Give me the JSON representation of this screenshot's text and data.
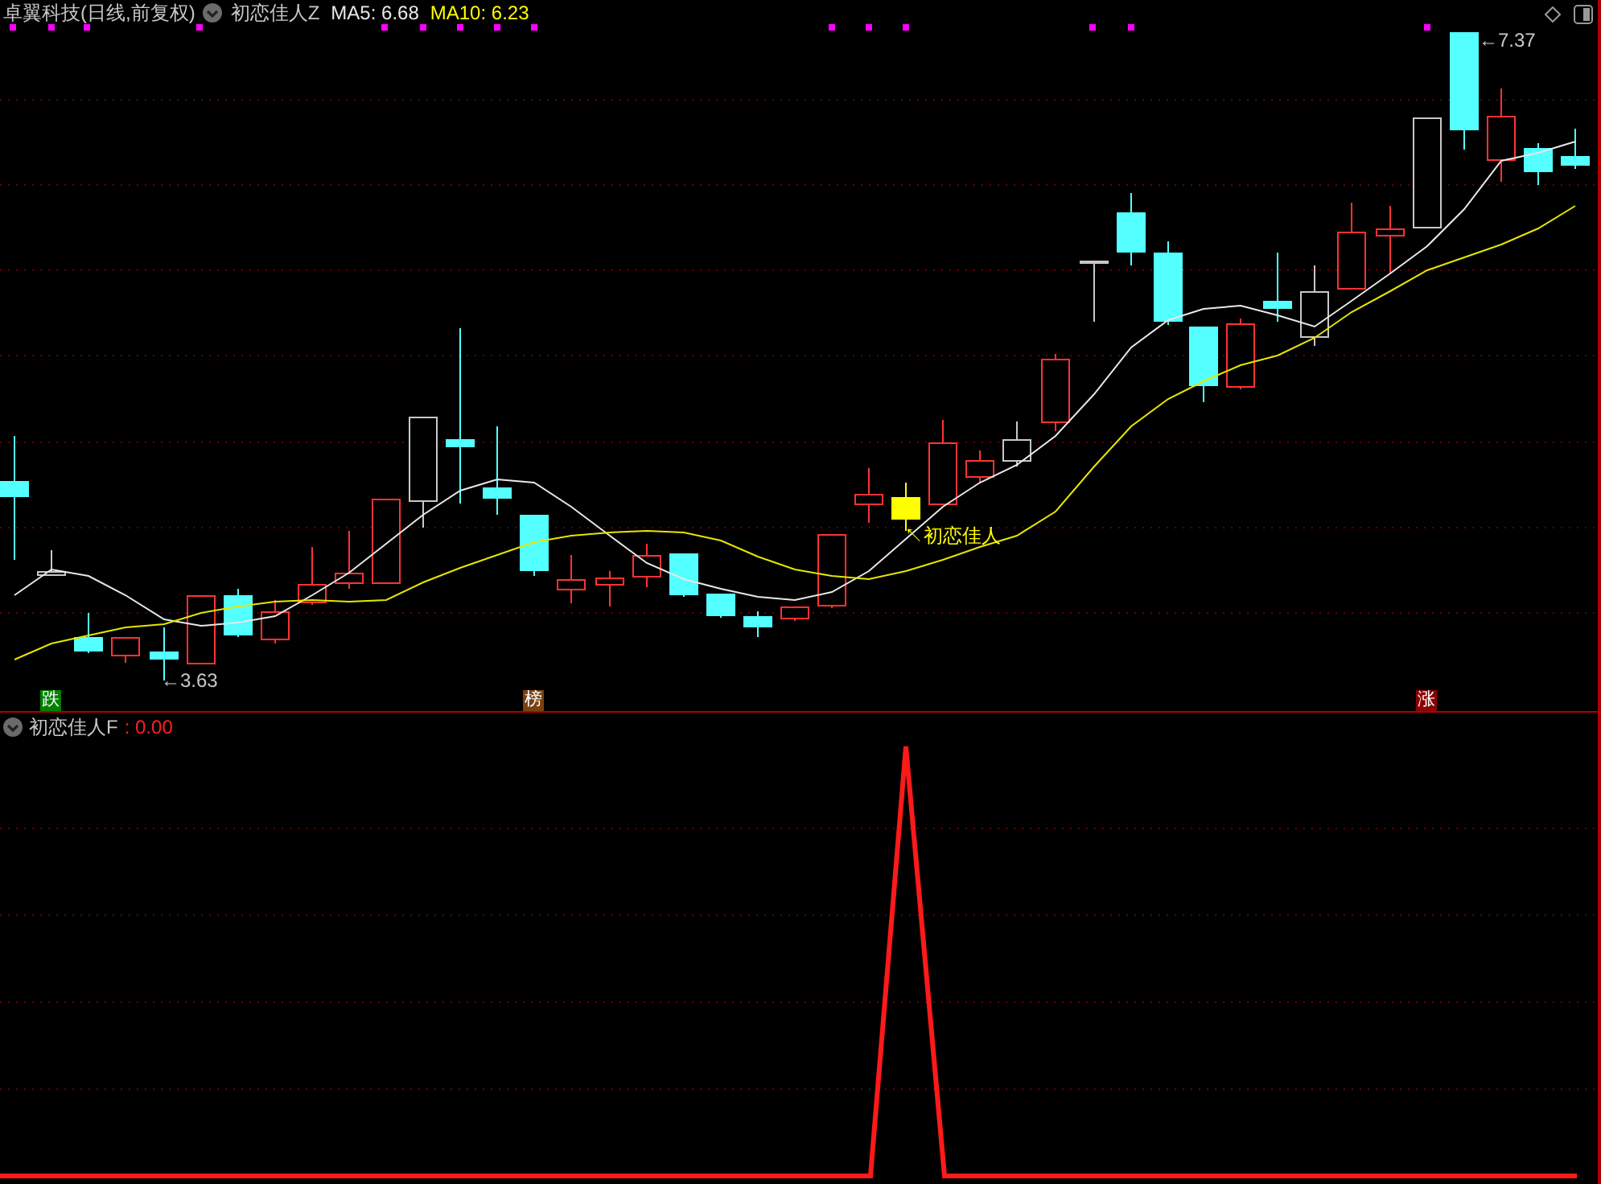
{
  "main_pane": {
    "title": "卓翼科技(日线,前复权)",
    "indicator": "初恋佳人Z",
    "readouts": [
      {
        "label": "MA5: 6.68",
        "kind": "ma5"
      },
      {
        "label": "MA10: 6.23",
        "kind": "ma10"
      }
    ],
    "annotations": [
      {
        "text": "←3.63",
        "kind": "low"
      },
      {
        "text": "←7.37",
        "kind": "high"
      },
      {
        "text": "↖初恋佳人",
        "kind": "signal"
      }
    ],
    "markers": [
      {
        "text": "跌",
        "color": "#008000",
        "kind": "left"
      },
      {
        "text": "榜",
        "color": "#7a4010",
        "kind": "middle"
      },
      {
        "text": "涨",
        "color": "#8b0000",
        "kind": "right"
      }
    ]
  },
  "sub_pane": {
    "indicator": "初恋佳人F",
    "reading": ": 0.00"
  }
}
